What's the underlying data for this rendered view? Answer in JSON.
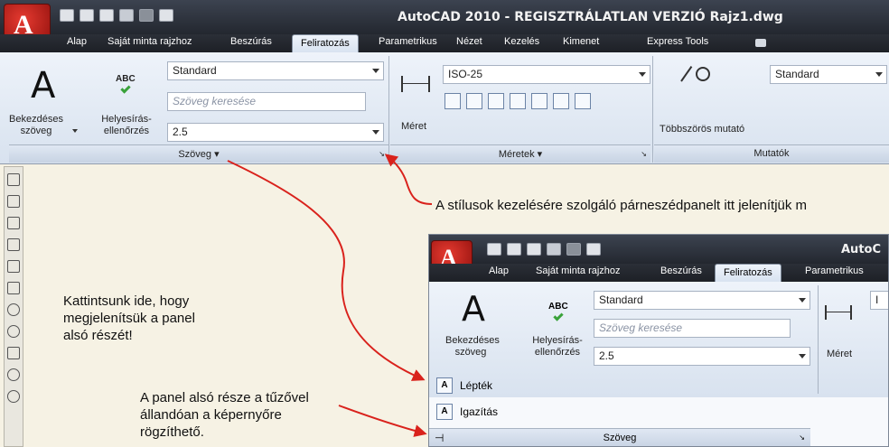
{
  "window": {
    "title": "AutoCAD 2010 - REGISZTRÁLATLAN VERZIÓ    Rajz1.dwg"
  },
  "app_button": {
    "letter": "A"
  },
  "tabs": [
    {
      "label": "Alap"
    },
    {
      "label": "Saját minta rajzhoz"
    },
    {
      "label": "Beszúrás"
    },
    {
      "label": "Feliratozás"
    },
    {
      "label": "Parametrikus"
    },
    {
      "label": "Nézet"
    },
    {
      "label": "Kezelés"
    },
    {
      "label": "Kimenet"
    },
    {
      "label": "Express Tools"
    }
  ],
  "panels": {
    "szoveg": {
      "title": "Szöveg",
      "big_button": {
        "icon": "A",
        "label1": "Bekezdéses",
        "label2": "szöveg"
      },
      "spell": {
        "icon": "ABC",
        "label1": "Helyesírás-",
        "label2": "ellenőrzés"
      },
      "style_combo": "Standard",
      "search_placeholder": "Szöveg keresése",
      "height_combo": "2.5"
    },
    "meretek": {
      "title": "Méretek",
      "big_button": {
        "label": "Méret"
      },
      "style_combo": "ISO-25"
    },
    "mutatok": {
      "title": "Mutatók",
      "big_button": {
        "label": "Többszörös mutató"
      },
      "style_combo": "Standard"
    }
  },
  "annotations": {
    "styles": "A stílusok kezelésére szolgáló párneszédpanelt itt jelenítjük m",
    "click_here": [
      "Kattintsunk ide, hogy",
      "megjelenítsük a panel",
      "alsó részét!"
    ],
    "pin": [
      "A panel alsó része a tűzővel",
      "állandóan a képernyőre",
      "rögzíthető."
    ]
  },
  "inset": {
    "title": "AutoC",
    "tabs": [
      {
        "label": "Alap"
      },
      {
        "label": "Saját minta rajzhoz"
      },
      {
        "label": "Beszúrás"
      },
      {
        "label": "Feliratozás"
      },
      {
        "label": "Parametrikus"
      }
    ],
    "panel": {
      "big_label1": "Bekezdéses",
      "big_label2": "szöveg",
      "spell_icon": "ABC",
      "spell_label1": "Helyesírás-",
      "spell_label2": "ellenőrzés",
      "style_combo": "Standard",
      "search_placeholder": "Szöveg keresése",
      "height_combo": "2.5",
      "dim_label": "Méret",
      "dim_combo": "I",
      "expanded": [
        {
          "icon": "A",
          "label": "Lépték"
        },
        {
          "icon": "A",
          "label": "Igazítás"
        }
      ],
      "footer_title": "Szöveg"
    }
  },
  "colors": {
    "arrow": "#d9221c",
    "titlebar": "#2b2f37",
    "ribbon": "#dfe7f2",
    "canvas": "#f6f2e4"
  }
}
